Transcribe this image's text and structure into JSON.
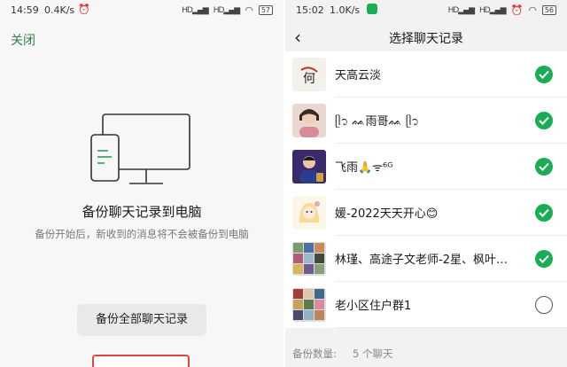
{
  "left_screen": {
    "status": {
      "time": "14:59",
      "network": "0.4K/s",
      "battery": "57"
    },
    "close_label": "关闭",
    "backup_title": "备份聊天记录到电脑",
    "backup_desc": "备份开始后，新收到的消息将不会被备份到电脑",
    "backup_all_button": "备份全部聊天记录",
    "colors": {
      "accent": "#2e7d4a",
      "highlight": "#e0463c"
    }
  },
  "right_screen": {
    "status": {
      "time": "15:02",
      "network": "1.0K/s",
      "battery": "56"
    },
    "title": "选择聊天记录",
    "back_icon": "chevron-left-icon",
    "chats": [
      {
        "name": "天高云淡",
        "checked": true
      },
      {
        "name": "ᥫ᭡ ᨐ雨哥ᨐ ᥫ᭡",
        "checked": true
      },
      {
        "name": "飞雨🙏ᯤ⁶ᴳ",
        "checked": true
      },
      {
        "name": "媛-2022天天开心😊",
        "checked": true
      },
      {
        "name": "林瑾、高途子文老师-2星、枫叶…",
        "checked": true
      },
      {
        "name": "老小区住户群1",
        "checked": false
      }
    ],
    "count_label": "备份数量:",
    "count_value": "5 个聊天",
    "colors": {
      "check": "#1aad55"
    }
  }
}
